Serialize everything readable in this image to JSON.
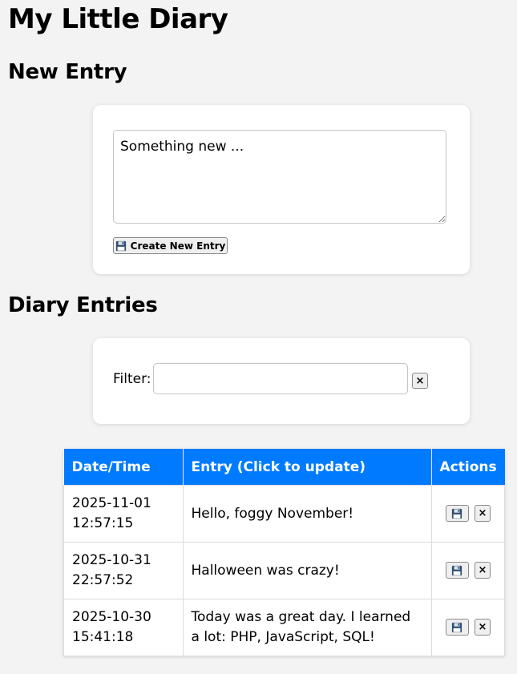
{
  "title": "My Little Diary",
  "new_entry": {
    "heading": "New Entry",
    "placeholder": "Something new ...",
    "create_label": "Create New Entry"
  },
  "entries_section": {
    "heading": "Diary Entries",
    "filter_label": "Filter:",
    "filter_value": "",
    "clear_label": "×"
  },
  "table": {
    "headers": [
      "Date/Time",
      "Entry (Click to update)",
      "Actions"
    ],
    "rows": [
      {
        "date": "2025-11-01",
        "time": "12:57:15",
        "entry": "Hello, foggy November!"
      },
      {
        "date": "2025-10-31",
        "time": "22:57:52",
        "entry": "Halloween was crazy!"
      },
      {
        "date": "2025-10-30",
        "time": "15:41:18",
        "entry": "Today was a great day. I learned a lot: PHP, JavaScript, SQL!"
      }
    ],
    "delete_label": "×"
  },
  "icons": {
    "save": "floppy-disk-icon",
    "delete": "x-icon"
  }
}
